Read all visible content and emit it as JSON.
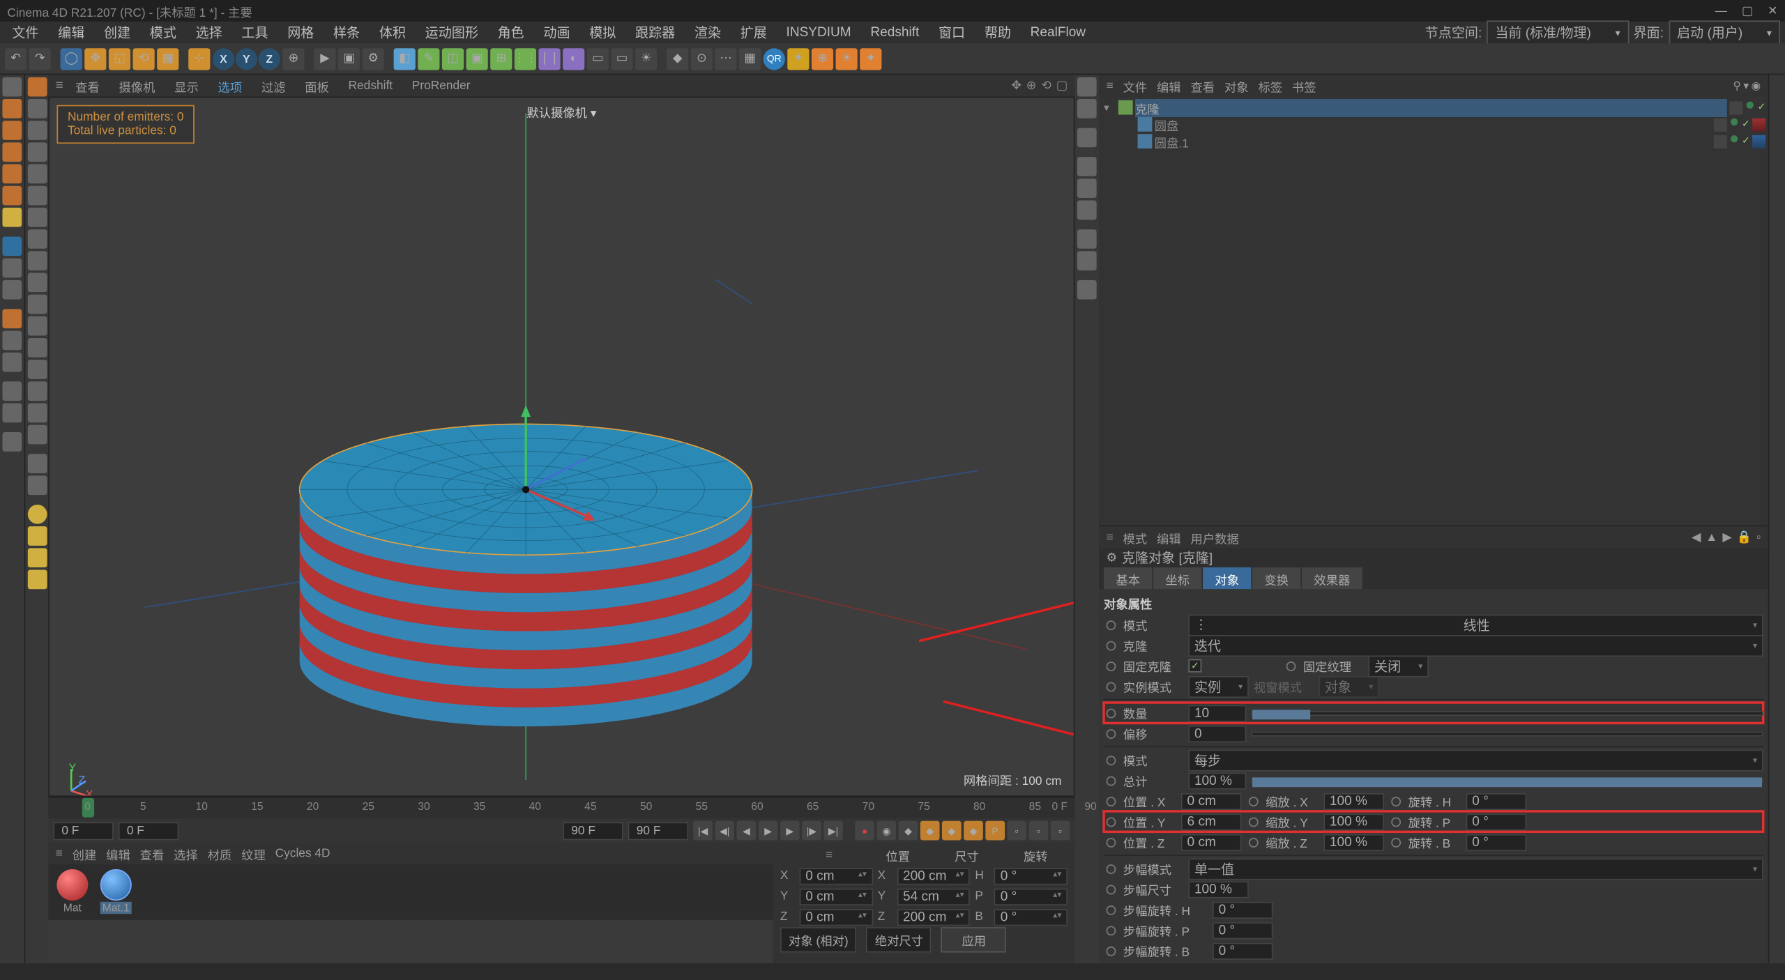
{
  "titlebar": {
    "title": "Cinema 4D R21.207 (RC) - [未标题 1 *] - 主要"
  },
  "menu": [
    "文件",
    "编辑",
    "创建",
    "模式",
    "选择",
    "工具",
    "网格",
    "样条",
    "体积",
    "运动图形",
    "角色",
    "动画",
    "模拟",
    "跟踪器",
    "渲染",
    "扩展",
    "INSYDIUM",
    "Redshift",
    "窗口",
    "帮助",
    "RealFlow"
  ],
  "menu_right": {
    "node_space_label": "节点空间:",
    "node_space_value": "当前 (标准/物理)",
    "layout_label": "界面:",
    "layout_value": "启动 (用户)"
  },
  "axes": [
    "X",
    "Y",
    "Z"
  ],
  "viewport_menu": [
    "查看",
    "摄像机",
    "显示",
    "选项",
    "过滤",
    "面板",
    "Redshift",
    "ProRender"
  ],
  "viewport_menu_active_index": 3,
  "camera_label": "默认摄像机 ▾",
  "overlay": {
    "emitters": "Number of emitters: 0",
    "particles": "Total live particles: 0"
  },
  "grid_label": "网格间距 : 100 cm",
  "axis_gizmo": {
    "x": "X",
    "y": "Y",
    "z": "Z"
  },
  "timeline": {
    "ticks": [
      0,
      5,
      10,
      15,
      20,
      25,
      30,
      35,
      40,
      45,
      50,
      55,
      60,
      65,
      70,
      75,
      80,
      85,
      90
    ],
    "start": "0 F",
    "start2": "0 F",
    "end": "90 F",
    "end2": "90 F",
    "cur": "0 F"
  },
  "materials_menu": [
    "创建",
    "编辑",
    "查看",
    "选择",
    "材质",
    "纹理",
    "Cycles 4D"
  ],
  "materials": [
    {
      "name": "Mat",
      "color": "red"
    },
    {
      "name": "Mat.1",
      "color": "blue"
    }
  ],
  "coord": {
    "headers": [
      "位置",
      "尺寸",
      "旋转"
    ],
    "rows": [
      {
        "axis": "X",
        "pos": "0 cm",
        "size": "200 cm",
        "rot": "0 °",
        "rotax": "H"
      },
      {
        "axis": "Y",
        "pos": "0 cm",
        "size": "54 cm",
        "rot": "0 °",
        "rotax": "P"
      },
      {
        "axis": "Z",
        "pos": "0 cm",
        "size": "200 cm",
        "rot": "0 °",
        "rotax": "B"
      }
    ],
    "mode1": "对象 (相对)",
    "mode2": "绝对尺寸",
    "apply": "应用"
  },
  "obj_mgr_menu": [
    "文件",
    "编辑",
    "查看",
    "对象",
    "标签",
    "书签"
  ],
  "obj_tree": {
    "root": {
      "name": "克隆",
      "sel": true
    },
    "children": [
      {
        "name": "圆盘",
        "tag": "red"
      },
      {
        "name": "圆盘.1",
        "tag": "blue"
      }
    ]
  },
  "attr_menu": [
    "模式",
    "编辑",
    "用户数据"
  ],
  "attr_title": "克隆对象 [克隆]",
  "attr_tabs": [
    "基本",
    "坐标",
    "对象",
    "变换",
    "效果器"
  ],
  "attr_tabs_active": 2,
  "attr": {
    "section": "对象属性",
    "mode_label": "模式",
    "mode_value": "线性",
    "clone_label": "克隆",
    "clone_value": "迭代",
    "fixclone_label": "固定克隆",
    "fixclone_check": true,
    "fixtex_label": "固定纹理",
    "fixtex_value": "关闭",
    "instmode_label": "实例模式",
    "instmode_value": "实例",
    "viewmode_label": "视窗模式",
    "viewmode_value": "对象",
    "count_label": "数量",
    "count_value": "10",
    "offset_label": "偏移",
    "offset_value": "0",
    "mode2_label": "模式",
    "mode2_value": "每步",
    "total_label": "总计",
    "total_value": "100 %",
    "pos_x_label": "位置 . X",
    "pos_x": "0 cm",
    "scale_x_label": "缩放 . X",
    "scale_x": "100 %",
    "rot_h_label": "旋转 . H",
    "rot_h": "0 °",
    "pos_y_label": "位置 . Y",
    "pos_y": "6 cm",
    "scale_y_label": "缩放 . Y",
    "scale_y": "100 %",
    "rot_p_label": "旋转 . P",
    "rot_p": "0 °",
    "pos_z_label": "位置 . Z",
    "pos_z": "0 cm",
    "scale_z_label": "缩放 . Z",
    "scale_z": "100 %",
    "rot_b_label": "旋转 . B",
    "rot_b": "0 °",
    "stepmode_label": "步幅模式",
    "stepmode_value": "单一值",
    "stepsize_label": "步幅尺寸",
    "stepsize_value": "100 %",
    "steprot_h_label": "步幅旋转 . H",
    "steprot_h": "0 °",
    "steprot_p_label": "步幅旋转 . P",
    "steprot_p": "0 °",
    "steprot_b_label": "步幅旋转 . B",
    "steprot_b": "0 °"
  }
}
